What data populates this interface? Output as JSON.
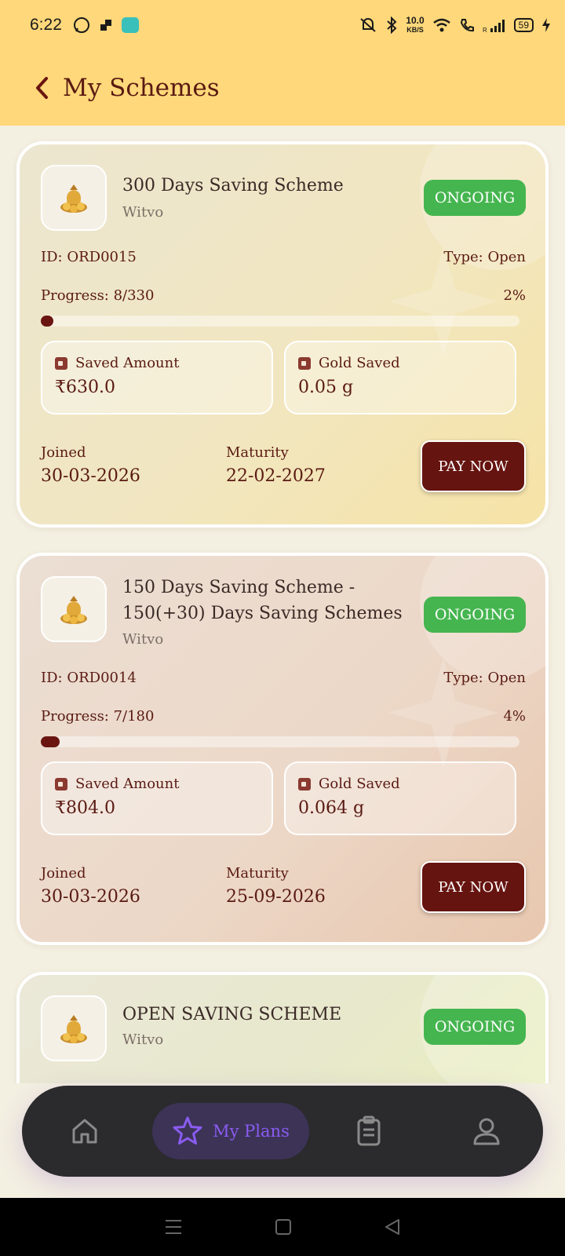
{
  "status_bar": {
    "time": "6:22",
    "network_speed_value": "10.0",
    "network_speed_unit": "KB/S",
    "battery": "59"
  },
  "header": {
    "title": "My Schemes"
  },
  "schemes": [
    {
      "title_line1": "300 Days Saving Scheme",
      "title_line2": "",
      "vendor": "Witvo",
      "status": "ONGOING",
      "id_text": "ID: ORD0015",
      "type_text": "Type: Open",
      "progress_text": "Progress: 8/330",
      "progress_percent_text": "2%",
      "progress_fraction": 0.024,
      "saved_amount_label": "Saved Amount",
      "saved_amount": "₹630.0",
      "gold_saved_label": "Gold Saved",
      "gold_saved": "0.05 g",
      "joined_label": "Joined",
      "joined": "30-03-2026",
      "maturity_label": "Maturity",
      "maturity": "22-02-2027",
      "pay_label": "PAY NOW"
    },
    {
      "title_line1": "150 Days Saving Scheme -",
      "title_line2": "150(+30) Days Saving Schemes",
      "vendor": "Witvo",
      "status": "ONGOING",
      "id_text": "ID: ORD0014",
      "type_text": "Type: Open",
      "progress_text": "Progress: 7/180",
      "progress_percent_text": "4%",
      "progress_fraction": 0.039,
      "saved_amount_label": "Saved Amount",
      "saved_amount": "₹804.0",
      "gold_saved_label": "Gold Saved",
      "gold_saved": "0.064 g",
      "joined_label": "Joined",
      "joined": "30-03-2026",
      "maturity_label": "Maturity",
      "maturity": "25-09-2026",
      "pay_label": "PAY NOW"
    },
    {
      "title_line1": "OPEN SAVING SCHEME",
      "vendor": "Witvo",
      "status": "ONGOING"
    }
  ],
  "bottom_nav": {
    "active_label": "My Plans",
    "items": [
      {
        "icon": "home-icon"
      },
      {
        "icon": "star-icon",
        "label": "My Plans"
      },
      {
        "icon": "clipboard-icon"
      },
      {
        "icon": "user-icon"
      }
    ]
  },
  "colors": {
    "header_bg": "#fed87a",
    "brand_maroon": "#661410",
    "badge_green": "#45b54f",
    "nav_bg": "#2b2a2d",
    "nav_active": "#8a5cf0"
  }
}
